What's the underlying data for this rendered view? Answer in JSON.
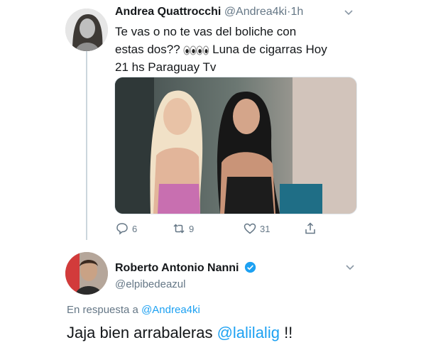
{
  "original_tweet": {
    "display_name": "Andrea Quattrocchi",
    "handle": "@Andrea4ki",
    "separator": "·",
    "time": "1h",
    "text_before_emoji": "Te vas o no te vas del boliche con estas dos??",
    "text_after_emoji": " Luna de cigarras Hoy 21 hs Paraguay Tv",
    "emoji": "eyes-emoji",
    "actions": {
      "reply_count": "6",
      "retweet_count": "9",
      "like_count": "31"
    }
  },
  "reply_tweet": {
    "display_name": "Roberto Antonio Nanni",
    "handle": "@elpibedeazul",
    "verified": true,
    "replying_to_prefix": "En respuesta a ",
    "replying_to_handle": "@Andrea4ki",
    "text_before_mention": "Jaja bien arrabaleras ",
    "mention": "@lalilalig",
    "text_after_mention": " !!"
  },
  "colors": {
    "link": "#1da1f2",
    "secondary_text": "#657786",
    "primary_text": "#14171a",
    "border": "#e1e8ed"
  }
}
